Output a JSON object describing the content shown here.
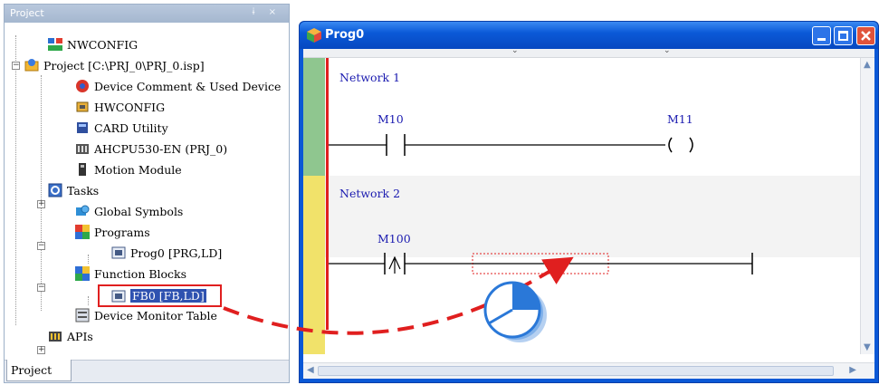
{
  "project_panel": {
    "header_title": "Project",
    "header_buttons": "ɨ ×",
    "tab_label": "Project",
    "tree": [
      {
        "label": "NWCONFIG",
        "icon": "network-config-icon"
      },
      {
        "label": "Project [C:\\PRJ_0\\PRJ_0.isp]",
        "icon": "project-icon",
        "toggle": "−"
      },
      {
        "label": "Device Comment & Used Device",
        "icon": "device-comment-icon"
      },
      {
        "label": "HWCONFIG",
        "icon": "hardware-config-icon"
      },
      {
        "label": "CARD Utility",
        "icon": "card-utility-icon"
      },
      {
        "label": "AHCPU530-EN  (PRJ_0)",
        "icon": "cpu-icon"
      },
      {
        "label": "Motion Module",
        "icon": "motion-module-icon"
      },
      {
        "label": "Tasks",
        "icon": "tasks-icon",
        "toggle": "+"
      },
      {
        "label": "Global Symbols",
        "icon": "global-symbols-icon"
      },
      {
        "label": "Programs",
        "icon": "programs-icon",
        "toggle": "−"
      },
      {
        "label": "Prog0 [PRG,LD]",
        "icon": "program-file-icon"
      },
      {
        "label": "Function Blocks",
        "icon": "function-blocks-icon",
        "toggle": "−"
      },
      {
        "label": "FB0 [FB,LD]",
        "icon": "function-block-file-icon",
        "selected": true
      },
      {
        "label": "Device Monitor Table",
        "icon": "monitor-table-icon"
      },
      {
        "label": "APIs",
        "icon": "apis-icon",
        "toggle": "+"
      }
    ]
  },
  "prog_window": {
    "title": "Prog0",
    "colors": {
      "title_bar": "#0b5ad8",
      "close_button": "#e0533b",
      "rail": "#e01f1f",
      "network1_bar": "#8fc68f",
      "network2_bar": "#f1e26a"
    }
  },
  "ladder": {
    "network1": {
      "label": "Network 1",
      "contact": "M10",
      "coil": "M11"
    },
    "network2": {
      "label": "Network 2",
      "contact": "M100"
    }
  },
  "annotation": {
    "arrow_color": "#e01f1f",
    "highlight_color": "#e01f1f"
  }
}
